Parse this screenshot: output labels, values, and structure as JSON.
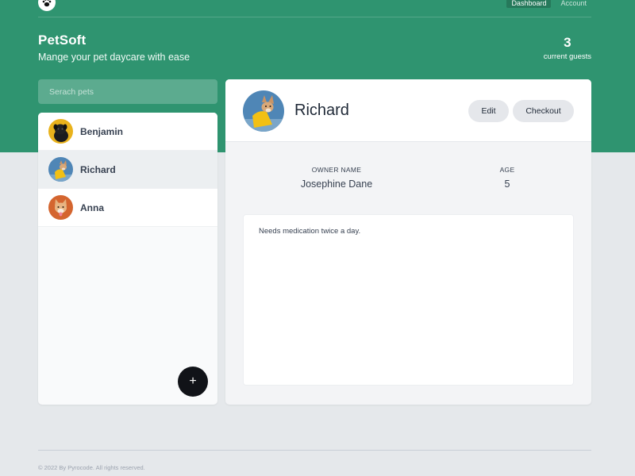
{
  "nav": {
    "logo_icon": "paw-icon",
    "links": [
      {
        "label": "Dashboard",
        "active": true
      },
      {
        "label": "Account",
        "active": false
      }
    ]
  },
  "header": {
    "title": "PetSoft",
    "subtitle": "Mange your pet daycare with ease",
    "guests_count": "3",
    "guests_label": "current guests"
  },
  "search": {
    "placeholder": "Serach pets"
  },
  "pets": [
    {
      "name": "Benjamin",
      "avatar": "black-dog-avatar",
      "selected": false
    },
    {
      "name": "Richard",
      "avatar": "corgi-yellow-avatar",
      "selected": true
    },
    {
      "name": "Anna",
      "avatar": "corgi-orange-avatar",
      "selected": false
    }
  ],
  "add_button_label": "+",
  "detail": {
    "name": "Richard",
    "edit_label": "Edit",
    "checkout_label": "Checkout",
    "owner_label": "OWNER NAME",
    "owner_value": "Josephine Dane",
    "age_label": "AGE",
    "age_value": "5",
    "notes": "Needs medication twice a day."
  },
  "footer": {
    "text": "© 2022 By Pyrocode. All rights reserved."
  },
  "colors": {
    "brand_green": "#2f9470",
    "page_bg": "#e5e8eb"
  }
}
